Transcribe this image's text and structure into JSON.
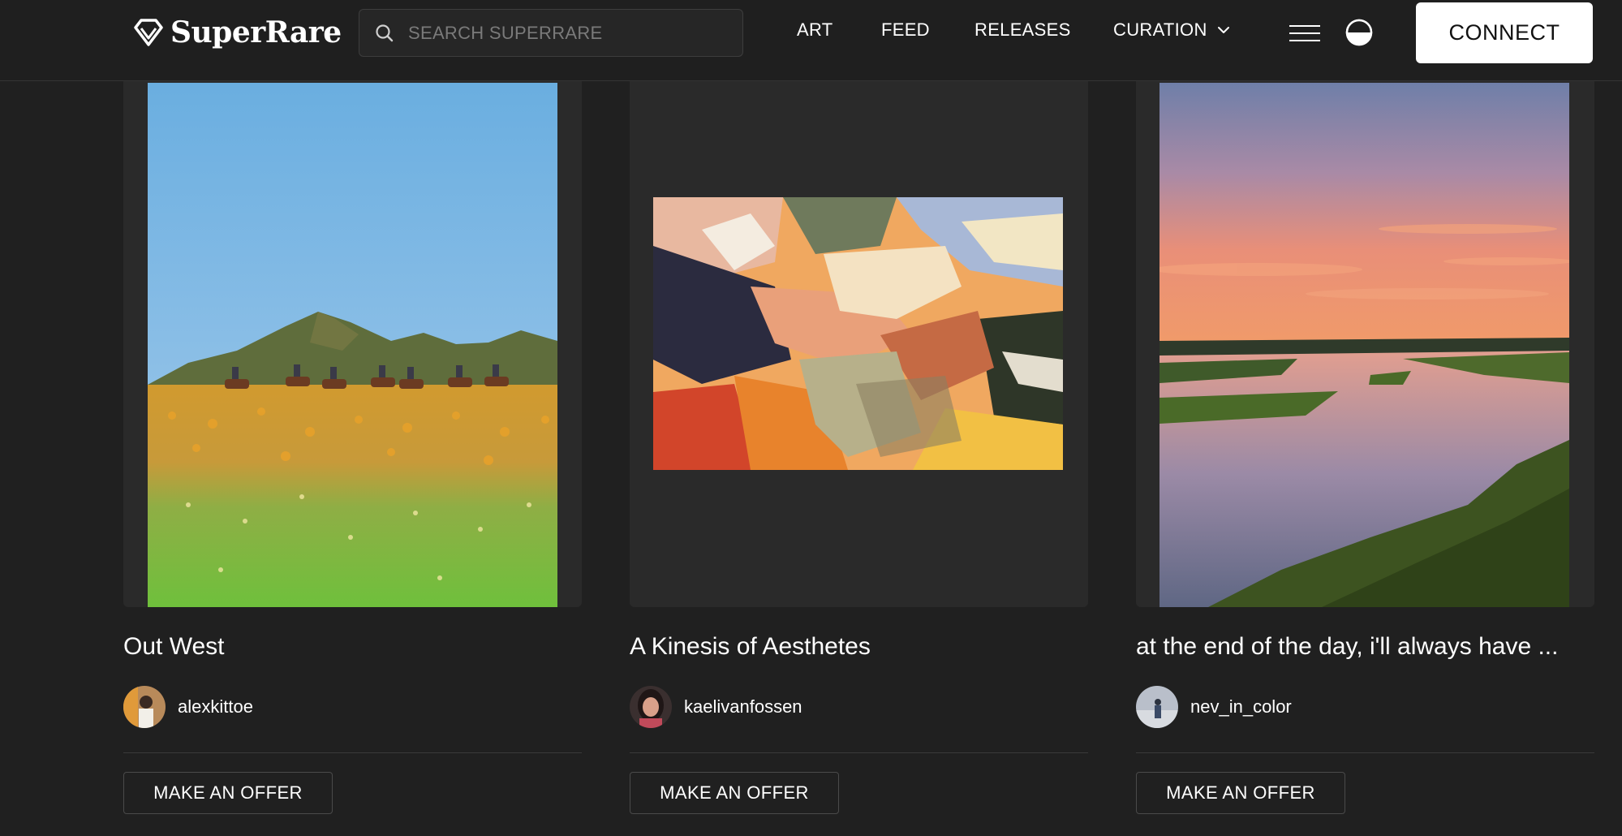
{
  "header": {
    "logo_text": "SuperRare",
    "search": {
      "placeholder": "SEARCH SUPERRARE",
      "value": ""
    },
    "nav": [
      {
        "label": "ART"
      },
      {
        "label": "FEED"
      },
      {
        "label": "RELEASES"
      },
      {
        "label": "CURATION",
        "has_dropdown": true
      }
    ],
    "icons": [
      "diamond-logo-icon",
      "search-icon",
      "chevron-down-icon",
      "hamburger-menu-icon",
      "theme-toggle-icon"
    ],
    "connect_label": "CONNECT"
  },
  "cards": [
    {
      "title": "Out West",
      "artist": "alexkittoe",
      "button_label": "MAKE AN OFFER"
    },
    {
      "title": "A Kinesis of Aesthetes",
      "artist": "kaelivanfossen",
      "button_label": "MAKE AN OFFER"
    },
    {
      "title": "at the end of the day, i'll always have ...",
      "artist": "nev_in_color",
      "button_label": "MAKE AN OFFER"
    }
  ],
  "colors": {
    "background": "#202020",
    "card_frame": "#2a2a2a",
    "connect_bg": "#ffffff",
    "text": "#ffffff"
  }
}
